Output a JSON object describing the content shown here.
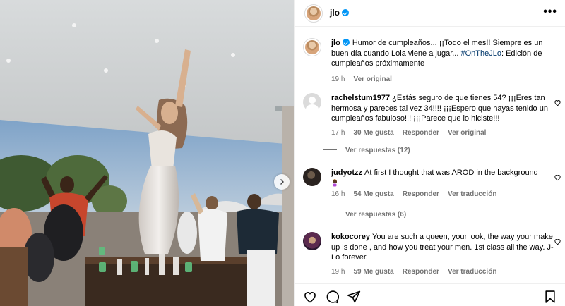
{
  "post": {
    "username": "jlo",
    "more_label": "•••"
  },
  "caption": {
    "username": "jlo",
    "text_before": "Humor de cumpleaños... ¡¡Todo el mes!! Siempre es un buen día cuando Lola viene a jugar... ",
    "hashtag": "#OnTheJLo",
    "text_after": ": Edición de cumpleaños próximamente",
    "time": "19 h",
    "see_original": "Ver original"
  },
  "comments": [
    {
      "username": "rachelstum1977",
      "text": "¿Estás seguro de que tienes 54? ¡¡¡Eres tan hermosa y pareces tal vez 34!!!! ¡¡¡Espero que hayas tenido un cumpleaños fabuloso!!! ¡¡¡Parece que lo hiciste!!!",
      "time": "17 h",
      "likes": "30 Me gusta",
      "reply": "Responder",
      "translate": "Ver original",
      "view_replies": "Ver respuestas (12)"
    },
    {
      "username": "judyotzz",
      "text": "At first I thought that was AROD in the background",
      "time": "16 h",
      "likes": "54 Me gusta",
      "reply": "Responder",
      "translate": "Ver traducción",
      "view_replies": "Ver respuestas (6)"
    },
    {
      "username": "kokocorey",
      "text": "You are such a queen, your look, the way your make up is done , and how you treat your men. 1st class all the way. J-Lo forever.",
      "time": "19 h",
      "likes": "59 Me gusta",
      "reply": "Responder",
      "translate": "Ver traducción"
    }
  ],
  "icons": {
    "verified": "verified-badge-icon",
    "like": "heart-icon",
    "comment": "comment-icon",
    "share": "send-icon",
    "save": "bookmark-icon",
    "next": "chevron-right-icon"
  },
  "colors": {
    "verified_blue": "#0095f6",
    "hashtag": "#00376b",
    "muted": "#737373"
  }
}
